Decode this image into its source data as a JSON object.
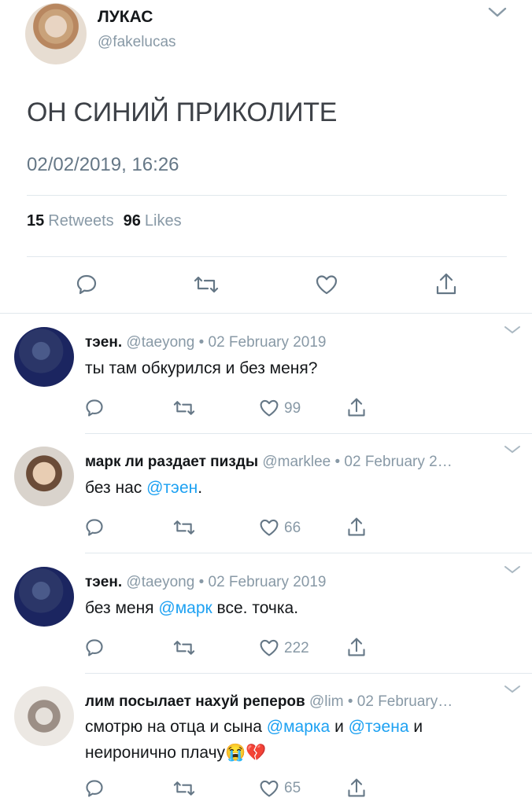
{
  "main_tweet": {
    "name": "ЛУКАС",
    "handle": "@fakelucas",
    "text": "ОН СИНИЙ ПРИКОЛИТЕ",
    "date": "02/02/2019, 16:26",
    "retweets_count": "15",
    "retweets_label": "Retweets",
    "likes_count": "96",
    "likes_label": "Likes"
  },
  "replies": [
    {
      "name": "тэен.",
      "meta": "@taeyong • 02 February 2019",
      "text_parts": [
        "ты там обкурился и без меня?"
      ],
      "likes": "99"
    },
    {
      "name": "марк ли раздает пизды",
      "meta": "@marklee • 02 February 2…",
      "text_a": "без нас ",
      "mention_a": "@тэен",
      "text_b": ".",
      "likes": "66"
    },
    {
      "name": "тэен.",
      "meta": "@taeyong • 02 February 2019",
      "text_a": "без меня ",
      "mention_a": "@марк",
      "text_b": " все. точка.",
      "likes": "222"
    },
    {
      "name": "лим посылает нахуй реперов",
      "meta": "@lim • 02 February…",
      "text_a": "смотрю на отца и сына ",
      "mention_a": "@марка",
      "text_b": " и ",
      "mention_b": "@тэена",
      "text_c": " и неиронично плачу",
      "emoji": "😭💔",
      "likes": "65"
    }
  ],
  "colors": {
    "accent": "#1da1f2",
    "muted": "#8899a6",
    "text": "#14171a",
    "divider": "#e1e8ed"
  }
}
